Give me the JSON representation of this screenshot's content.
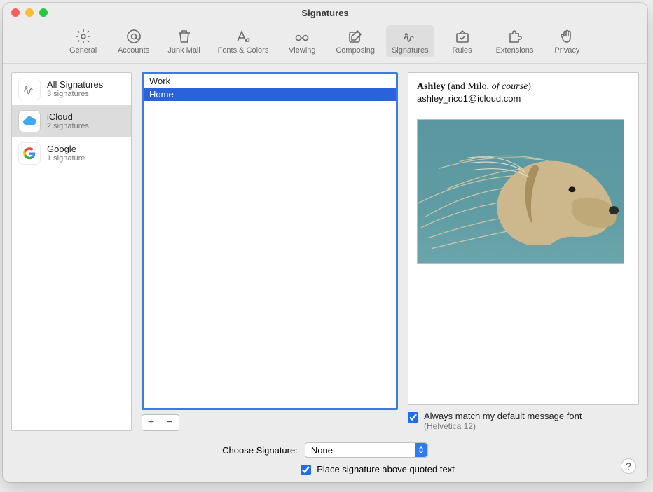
{
  "window": {
    "title": "Signatures"
  },
  "toolbar": {
    "items": [
      {
        "label": "General"
      },
      {
        "label": "Accounts"
      },
      {
        "label": "Junk Mail"
      },
      {
        "label": "Fonts & Colors"
      },
      {
        "label": "Viewing"
      },
      {
        "label": "Composing"
      },
      {
        "label": "Signatures"
      },
      {
        "label": "Rules"
      },
      {
        "label": "Extensions"
      },
      {
        "label": "Privacy"
      }
    ]
  },
  "accounts": [
    {
      "name": "All Signatures",
      "count": "3 signatures"
    },
    {
      "name": "iCloud",
      "count": "2 signatures"
    },
    {
      "name": "Google",
      "count": "1 signature"
    }
  ],
  "signatures": [
    {
      "label": "Work"
    },
    {
      "label": "Home"
    }
  ],
  "addremove": {
    "add": "+",
    "remove": "−"
  },
  "preview": {
    "name_bold": "Ashley",
    "name_rest": " (and Milo, ",
    "name_italic": "of course",
    "name_close": ")",
    "email": "ashley_rico1@icloud.com"
  },
  "options": {
    "match_font_label": "Always match my default message font",
    "match_font_sub": "(Helvetica 12)",
    "choose_label": "Choose Signature:",
    "choose_value": "None",
    "place_label": "Place signature above quoted text"
  },
  "help": "?"
}
